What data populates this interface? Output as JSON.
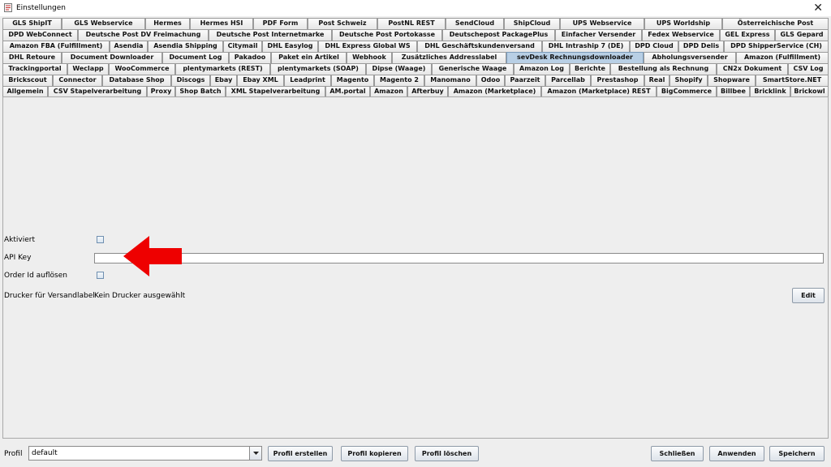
{
  "window": {
    "title": "Einstellungen"
  },
  "tab_rows": [
    [
      "GLS ShipIT",
      "GLS Webservice",
      "Hermes",
      "Hermes HSI",
      "PDF Form",
      "Post Schweiz",
      "PostNL REST",
      "SendCloud",
      "ShipCloud",
      "UPS Webservice",
      "UPS Worldship",
      "Österreichische Post"
    ],
    [
      "DPD WebConnect",
      "Deutsche Post DV Freimachung",
      "Deutsche Post Internetmarke",
      "Deutsche Post Portokasse",
      "Deutschepost PackagePlus",
      "Einfacher Versender",
      "Fedex Webservice",
      "GEL Express",
      "GLS Gepard"
    ],
    [
      "Amazon FBA (Fulfillment)",
      "Asendia",
      "Asendia Shipping",
      "Citymail",
      "DHL Easylog",
      "DHL Express Global WS",
      "DHL Geschäftskundenversand",
      "DHL Intraship 7 (DE)",
      "DPD Cloud",
      "DPD Delis",
      "DPD ShipperService (CH)"
    ],
    [
      "DHL Retoure",
      "Document Downloader",
      "Document Log",
      "Pakadoo",
      "Paket ein Artikel",
      "Webhook",
      "Zusätzliches Addresslabel",
      "sevDesk Rechnungsdownloader",
      "Abholungsversender",
      "Amazon (Fulfillment)"
    ],
    [
      "Trackingportal",
      "Weclapp",
      "WooCommerce",
      "plentymarkets (REST)",
      "plentymarkets (SOAP)",
      "Dipse (Waage)",
      "Generische Waage",
      "Amazon Log",
      "Berichte",
      "Bestellung als Rechnung",
      "CN2x Dokument",
      "CSV Log"
    ],
    [
      "Brickscout",
      "Connector",
      "Database Shop",
      "Discogs",
      "Ebay",
      "Ebay XML",
      "Leadprint",
      "Magento",
      "Magento 2",
      "Manomano",
      "Odoo",
      "Paarzeit",
      "Parcellab",
      "Prestashop",
      "Real",
      "Shopify",
      "Shopware",
      "SmartStore.NET"
    ],
    [
      "Allgemein",
      "CSV Stapelverarbeitung",
      "Proxy",
      "Shop Batch",
      "XML Stapelverarbeitung",
      "AM.portal",
      "Amazon",
      "Afterbuy",
      "Amazon (Marketplace)",
      "Amazon (Marketplace) REST",
      "BigCommerce",
      "Billbee",
      "Bricklink",
      "Brickowl"
    ]
  ],
  "selected_tab": "sevDesk Rechnungsdownloader",
  "form": {
    "aktiviert_label": "Aktiviert",
    "aktiviert_checked": false,
    "api_key_label": "API Key",
    "api_key_value": "",
    "order_id_label": "Order Id auflösen",
    "order_id_checked": false,
    "printer_label": "Drucker für Versandlabel",
    "printer_value": "Kein Drucker ausgewählt",
    "edit_label": "Edit"
  },
  "annotation": {
    "color": "#ee0000",
    "icon": "red-arrow-left"
  },
  "footer": {
    "profil_label": "Profil",
    "profil_value": "default",
    "create_label": "Profil erstellen",
    "copy_label": "Profil kopieren",
    "delete_label": "Profil löschen",
    "close_label": "Schließen",
    "apply_label": "Anwenden",
    "save_label": "Speichern"
  }
}
